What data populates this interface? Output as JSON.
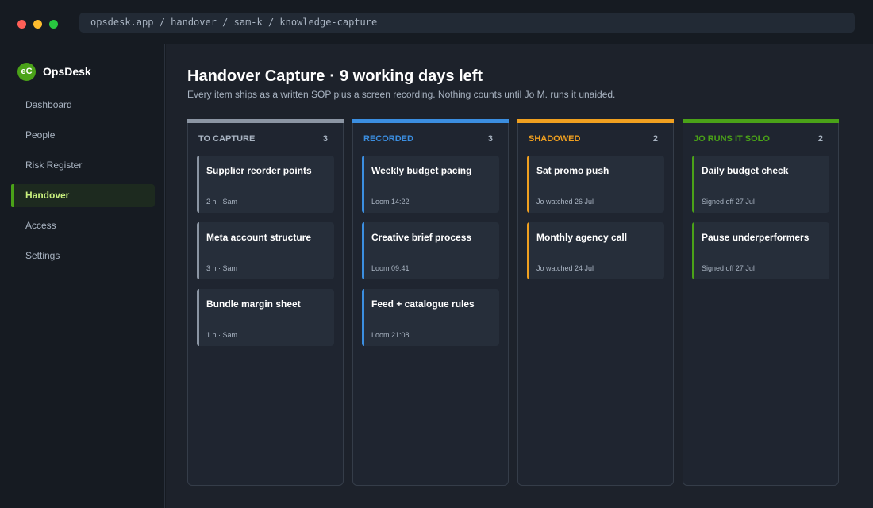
{
  "window": {
    "url": "opsdesk.app / handover / sam-k / knowledge-capture"
  },
  "sidebar": {
    "brand": {
      "logo": "eC",
      "name": "OpsDesk"
    },
    "items": [
      {
        "label": "Dashboard",
        "active": false
      },
      {
        "label": "People",
        "active": false
      },
      {
        "label": "Risk Register",
        "active": false
      },
      {
        "label": "Handover",
        "active": true
      },
      {
        "label": "Access",
        "active": false
      },
      {
        "label": "Settings",
        "active": false
      }
    ]
  },
  "header": {
    "title": "Handover Capture",
    "separator": "·",
    "days_left": "9 working days left",
    "subtitle": "Every item ships as a written SOP plus a screen recording. Nothing counts until Jo M. runs it unaided."
  },
  "colors": {
    "to_capture": "#8b95a3",
    "recorded": "#3b8ee0",
    "shadowed": "#f0a020",
    "solo": "#4aa218"
  },
  "board": {
    "columns": [
      {
        "title": "TO CAPTURE",
        "count": "3",
        "title_color": "#a9b4c2",
        "accent": "#8b95a3",
        "cards": [
          {
            "title": "Supplier reorder points",
            "meta": "2 h · Sam"
          },
          {
            "title": "Meta account structure",
            "meta": "3 h · Sam"
          },
          {
            "title": "Bundle margin sheet",
            "meta": "1 h · Sam"
          }
        ]
      },
      {
        "title": "RECORDED",
        "count": "3",
        "title_color": "#3b8ee0",
        "accent": "#3b8ee0",
        "cards": [
          {
            "title": "Weekly budget pacing",
            "meta": "Loom 14:22"
          },
          {
            "title": "Creative brief process",
            "meta": "Loom 09:41"
          },
          {
            "title": "Feed + catalogue rules",
            "meta": "Loom 21:08"
          }
        ]
      },
      {
        "title": "SHADOWED",
        "count": "2",
        "title_color": "#f0a020",
        "accent": "#f0a020",
        "cards": [
          {
            "title": "Sat promo push",
            "meta": "Jo watched 26 Jul"
          },
          {
            "title": "Monthly agency call",
            "meta": "Jo watched 24 Jul"
          }
        ]
      },
      {
        "title": "JO RUNS IT SOLO",
        "count": "2",
        "title_color": "#4aa218",
        "accent": "#4aa218",
        "cards": [
          {
            "title": "Daily budget check",
            "meta": "Signed off 27 Jul"
          },
          {
            "title": "Pause underperformers",
            "meta": "Signed off 27 Jul"
          }
        ]
      }
    ]
  }
}
